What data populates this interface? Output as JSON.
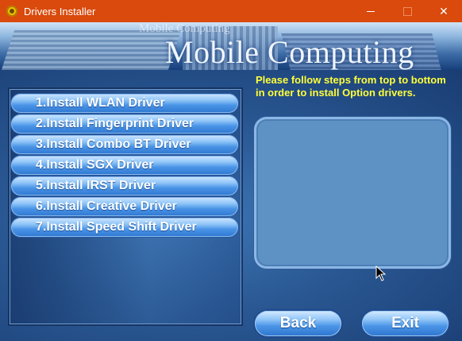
{
  "window": {
    "title": "Drivers Installer"
  },
  "banner": {
    "ghost_text": "Mobile Computing",
    "brand_text": "Mobile Computing"
  },
  "instructions": "Please follow steps from top to bottom in order to install Option drivers.",
  "drivers": [
    "1.Install WLAN Driver",
    "2.Install Fingerprint Driver",
    "3.Install Combo BT Driver",
    "4.Install SGX Driver",
    "5.Install IRST Driver",
    "6.Install Creative Driver",
    "7.Install Speed Shift Driver"
  ],
  "buttons": {
    "back": "Back",
    "exit": "Exit"
  },
  "icons": {
    "app": "installer-disc-icon",
    "minimize": "minimize-icon",
    "maximize": "maximize-icon",
    "close": "close-icon",
    "cursor": "mouse-pointer-icon"
  }
}
